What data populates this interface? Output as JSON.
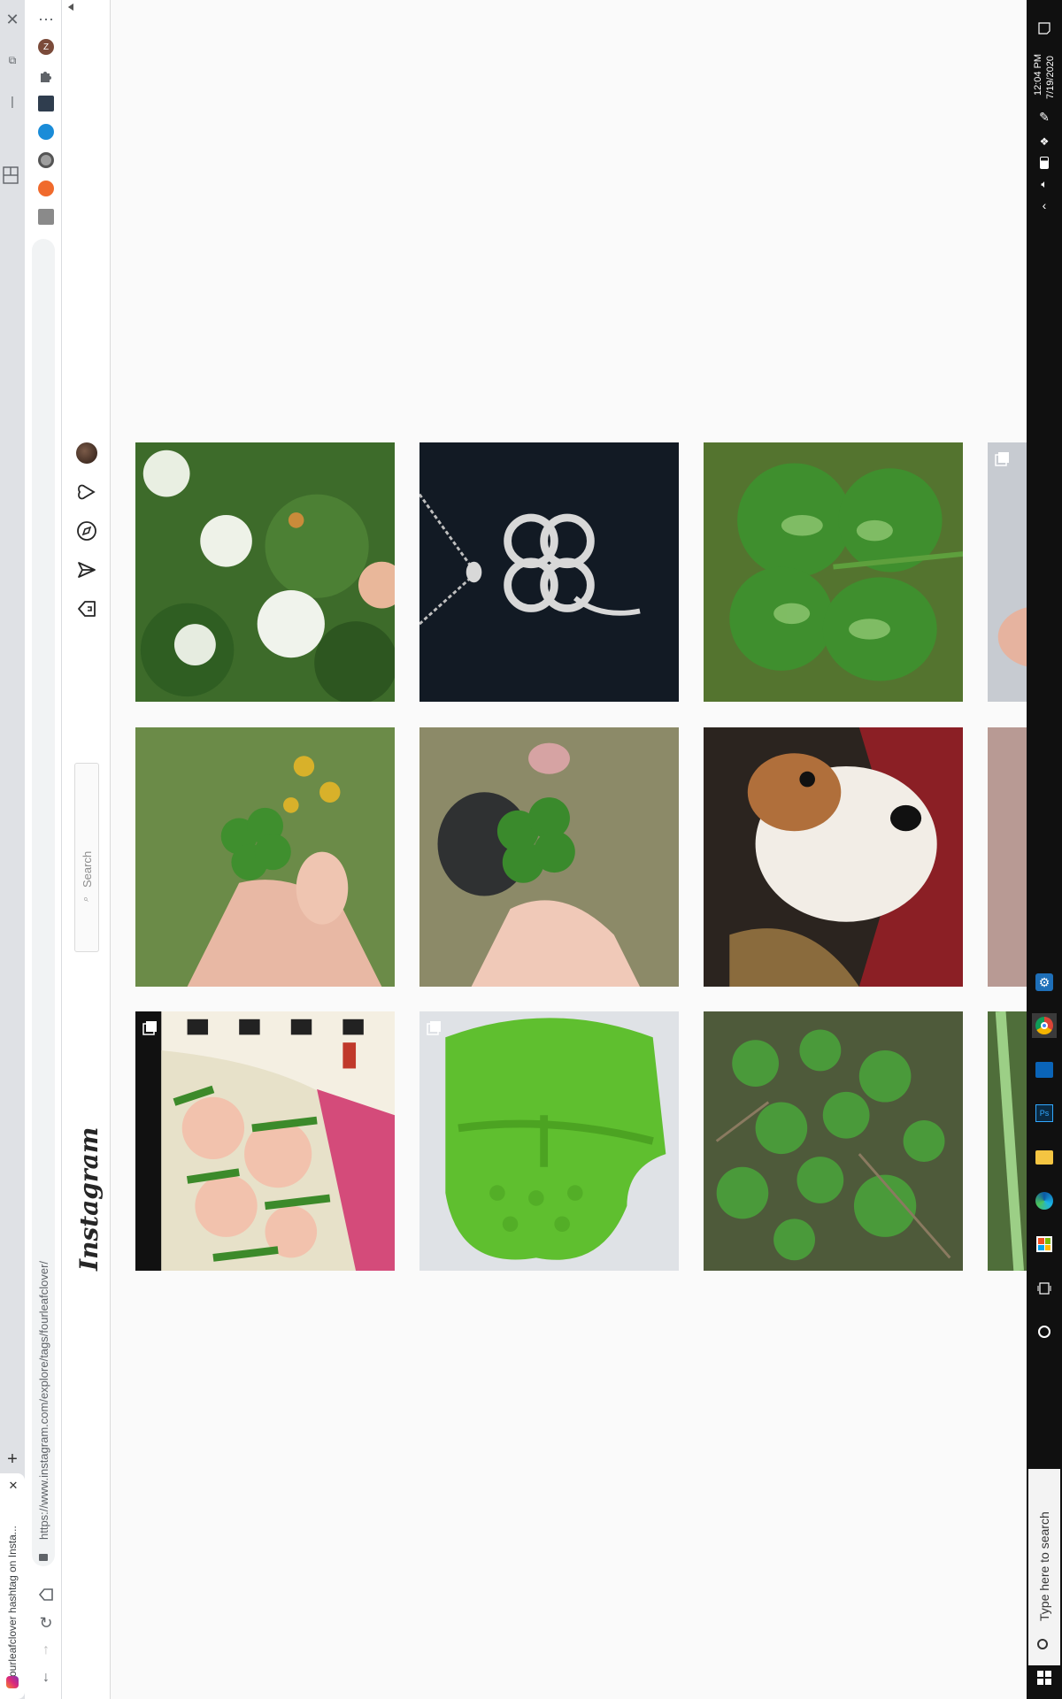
{
  "browser": {
    "tab_title": "#fourleafclover hashtag on Insta...",
    "url": "https://www.instagram.com/explore/tags/fourleafclover/",
    "new_tab_label": "+",
    "profile_initial": "Z"
  },
  "instagram": {
    "logo": "Instagram",
    "search_placeholder": "Search",
    "nav_icons": [
      "home-icon",
      "direct-icon",
      "explore-icon",
      "activity-icon",
      "profile-avatar"
    ]
  },
  "posts": [
    {
      "id": "p1",
      "description_icon": "clover-flowers",
      "multi": false
    },
    {
      "id": "p2",
      "description_icon": "clover-necklace",
      "multi": false
    },
    {
      "id": "p3",
      "description_icon": "four-leaf-clover-closeup",
      "multi": false
    },
    {
      "id": "p4",
      "description_icon": "partial-photo",
      "multi": true
    },
    {
      "id": "p5",
      "description_icon": "clover-in-hand",
      "multi": false
    },
    {
      "id": "p6",
      "description_icon": "clover-in-fingers",
      "multi": false
    },
    {
      "id": "p7",
      "description_icon": "corgi-dog",
      "multi": false
    },
    {
      "id": "p8",
      "description_icon": "partial-photo",
      "multi": false
    },
    {
      "id": "p9",
      "description_icon": "illustration-artwork",
      "multi": true
    },
    {
      "id": "p10",
      "description_icon": "crochet-clover",
      "multi": true
    },
    {
      "id": "p11",
      "description_icon": "clover-patch",
      "multi": false
    },
    {
      "id": "p12",
      "description_icon": "partial-photo",
      "multi": false
    }
  ],
  "taskbar": {
    "search_placeholder": "Type here to search",
    "time": "12:04 PM",
    "date": "7/19/2020"
  },
  "colors": {
    "clover_green": "#3f8f2e",
    "necklace_bg": "#121a24",
    "clover_bg": "#54742f",
    "instagram_gradient_start": "#f58529",
    "instagram_gradient_end": "#8134af"
  }
}
